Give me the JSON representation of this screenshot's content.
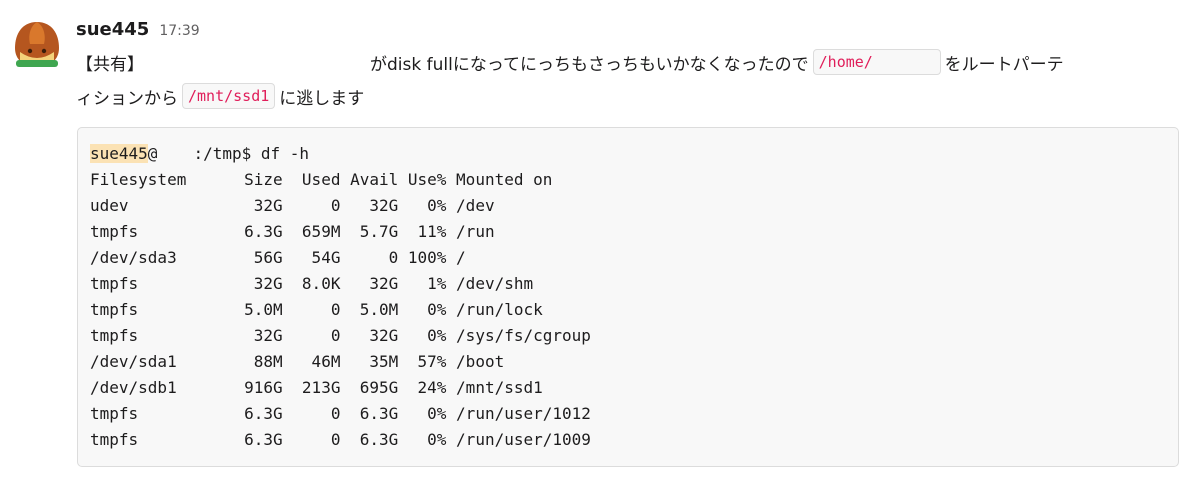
{
  "message": {
    "author": "sue445",
    "time": "17:39",
    "avatar_icon": "chestnut-icon",
    "tag": "【共有】",
    "text_after_tag": "がdisk fullになってにっちもさっちもいかなくなったので",
    "code_home": "/home/",
    "text_after_home": "をルートパーテ",
    "line2_prefix": "ィションから",
    "code_mnt": "/mnt/ssd1",
    "line2_suffix": "に逃します"
  },
  "terminal": {
    "prompt_user": "sue445",
    "prompt_at": "@",
    "prompt_rest": ":/tmp$ df -h",
    "header": "Filesystem      Size  Used Avail Use% Mounted on",
    "rows": [
      "udev             32G     0   32G   0% /dev",
      "tmpfs           6.3G  659M  5.7G  11% /run",
      "/dev/sda3        56G   54G     0 100% /",
      "tmpfs            32G  8.0K   32G   1% /dev/shm",
      "tmpfs           5.0M     0  5.0M   0% /run/lock",
      "tmpfs            32G     0   32G   0% /sys/fs/cgroup",
      "/dev/sda1        88M   46M   35M  57% /boot",
      "/dev/sdb1       916G  213G  695G  24% /mnt/ssd1",
      "tmpfs           6.3G     0  6.3G   0% /run/user/1012",
      "tmpfs           6.3G     0  6.3G   0% /run/user/1009"
    ]
  },
  "colors": {
    "code_text": "#e01e5a",
    "code_bg": "#f8f8f8",
    "highlight": "#fbe2b4"
  }
}
